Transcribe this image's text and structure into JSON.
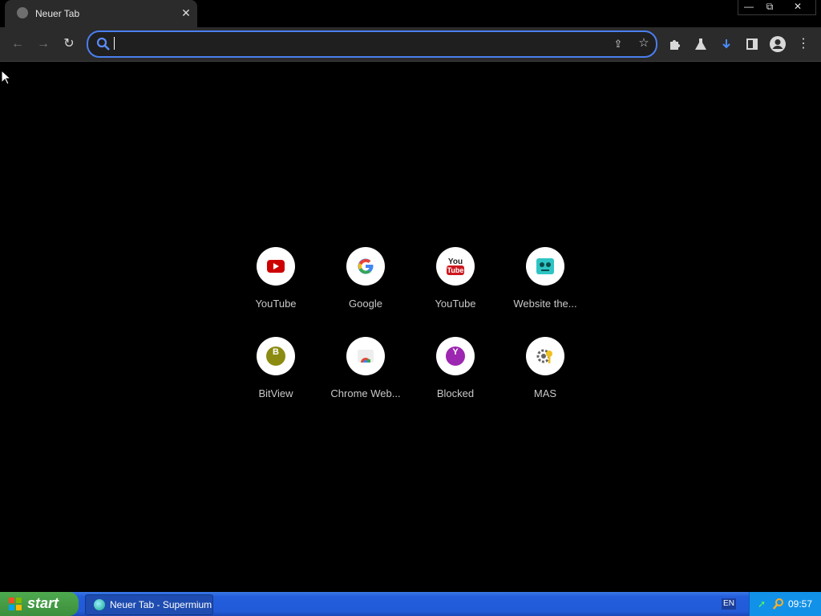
{
  "browser": {
    "tab_title": "Neuer Tab",
    "tab_close": "✕",
    "window_controls": {
      "minimize": "—",
      "restore": "⧉",
      "close": "✕"
    },
    "nav": {
      "back": "←",
      "forward": "→",
      "reload": "↻"
    },
    "omnibox": {
      "value": "",
      "placeholder": ""
    },
    "toolbar_icons": [
      "puzzle-icon",
      "flask-icon",
      "download-icon",
      "side-panel-icon",
      "profile-icon",
      "menu-icon"
    ]
  },
  "shortcuts": [
    {
      "label": "YouTube",
      "icon": "youtube-play-icon",
      "color": "#cc0000"
    },
    {
      "label": "Google",
      "icon": "google-g-icon",
      "color": "#4285f4"
    },
    {
      "label": "YouTube",
      "icon": "youtube-classic-icon",
      "color": "#cc181e"
    },
    {
      "label": "Website the...",
      "icon": "robot-face-icon",
      "color": "#2ec4c4"
    },
    {
      "label": "BitView",
      "icon": "b-circle-icon",
      "color": "#8b8b12"
    },
    {
      "label": "Chrome Web...",
      "icon": "webstore-icon",
      "color": "#dd4b39"
    },
    {
      "label": "Blocked",
      "icon": "y-circle-icon",
      "color": "#9c27b0"
    },
    {
      "label": "MAS",
      "icon": "gear-key-icon",
      "color": "#f0c020"
    }
  ],
  "taskbar": {
    "start_label": "start",
    "task_label": "Neuer Tab - Supermium",
    "language": "EN",
    "clock": "09:57"
  }
}
